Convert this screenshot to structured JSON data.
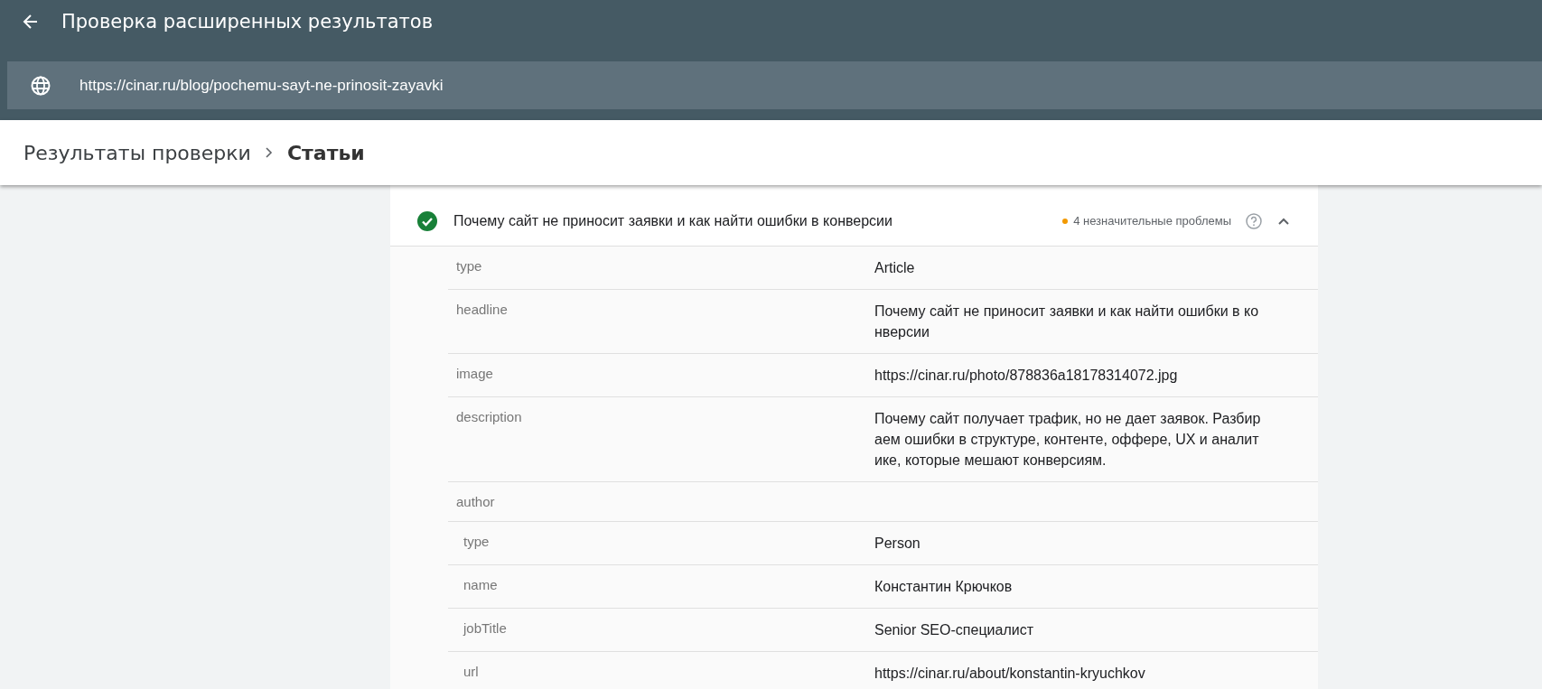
{
  "header": {
    "title": "Проверка расширенных результатов"
  },
  "url_bar": {
    "url": "https://cinar.ru/blog/pochemu-sayt-ne-prinosit-zayavki"
  },
  "breadcrumb": [
    {
      "label": "Результаты проверки",
      "current": false
    },
    {
      "label": "Статьи",
      "current": true
    }
  ],
  "item": {
    "title": "Почему сайт не приносит заявки и как найти ошибки в конверсии",
    "valid": true,
    "issues": "4 незначительные проблемы",
    "expanded": true
  },
  "properties": [
    {
      "name": "type",
      "value": "Article"
    },
    {
      "name": "headline",
      "value": "Почему сайт не приносит заявки и как найти ошибки в конверсии"
    },
    {
      "name": "image",
      "value": "https://cinar.ru/photo/878836a18178314072.jpg"
    },
    {
      "name": "description",
      "value": "Почему сайт получает трафик, но не дает заявок. Разбираем ошибки в структуре, контенте, оффере, UX и аналитике, которые мешают конверсиям."
    },
    {
      "name": "author",
      "children": [
        {
          "name": "type",
          "value": "Person"
        },
        {
          "name": "name",
          "value": "Константин Крючков"
        },
        {
          "name": "jobTitle",
          "value": "Senior SEO-специалист"
        },
        {
          "name": "url",
          "value": "https://cinar.ru/about/konstantin-kryuchkov"
        }
      ]
    }
  ]
}
